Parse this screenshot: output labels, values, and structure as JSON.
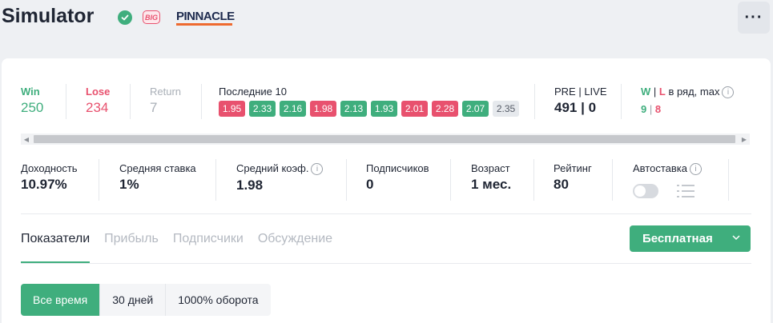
{
  "header": {
    "title": "Simulator",
    "big_badge": "BIG",
    "bookmaker": "PINNACLE",
    "more_label": "···"
  },
  "stats_top": {
    "win": {
      "label": "Win",
      "value": "250",
      "color": "#3fae7d"
    },
    "lose": {
      "label": "Lose",
      "value": "234",
      "color": "#e8516e"
    },
    "return": {
      "label": "Return",
      "value": "7",
      "color": "#a9afb7"
    },
    "last10": {
      "label": "Последние 10",
      "results": [
        {
          "value": "1.95",
          "status": "lose"
        },
        {
          "value": "2.33",
          "status": "win"
        },
        {
          "value": "2.16",
          "status": "win"
        },
        {
          "value": "1.98",
          "status": "lose"
        },
        {
          "value": "2.13",
          "status": "win"
        },
        {
          "value": "1.93",
          "status": "win"
        },
        {
          "value": "2.01",
          "status": "lose"
        },
        {
          "value": "2.28",
          "status": "lose"
        },
        {
          "value": "2.07",
          "status": "win"
        },
        {
          "value": "2.35",
          "status": "return"
        }
      ]
    },
    "pre_live": {
      "label": "PRE | LIVE",
      "value": "491 | 0"
    },
    "streak": {
      "label_w": "W",
      "label_sep": " | ",
      "label_l": "L",
      "label_rest": " в ряд, max",
      "value_w": "9",
      "value_sep": " | ",
      "value_l": "8"
    }
  },
  "stats_bottom": {
    "yield": {
      "label": "Доходность",
      "value": "10.97%"
    },
    "avg_stake": {
      "label": "Средняя ставка",
      "value": "1%"
    },
    "avg_odds": {
      "label": "Средний коэф.",
      "value": "1.98"
    },
    "subscribers": {
      "label": "Подписчиков",
      "value": "0"
    },
    "age": {
      "label": "Возраст",
      "value": "1 мес."
    },
    "rating": {
      "label": "Рейтинг",
      "value": "80"
    },
    "autobet": {
      "label": "Автоставка",
      "enabled": false
    }
  },
  "tabs": [
    {
      "label": "Показатели",
      "active": true
    },
    {
      "label": "Прибыль",
      "active": false
    },
    {
      "label": "Подписчики",
      "active": false
    },
    {
      "label": "Обсуждение",
      "active": false
    }
  ],
  "plan_button": {
    "label": "Бесплатная"
  },
  "filters": [
    {
      "label": "Все время",
      "active": true
    },
    {
      "label": "30 дней",
      "active": false
    },
    {
      "label": "1000% оборота",
      "active": false
    }
  ]
}
